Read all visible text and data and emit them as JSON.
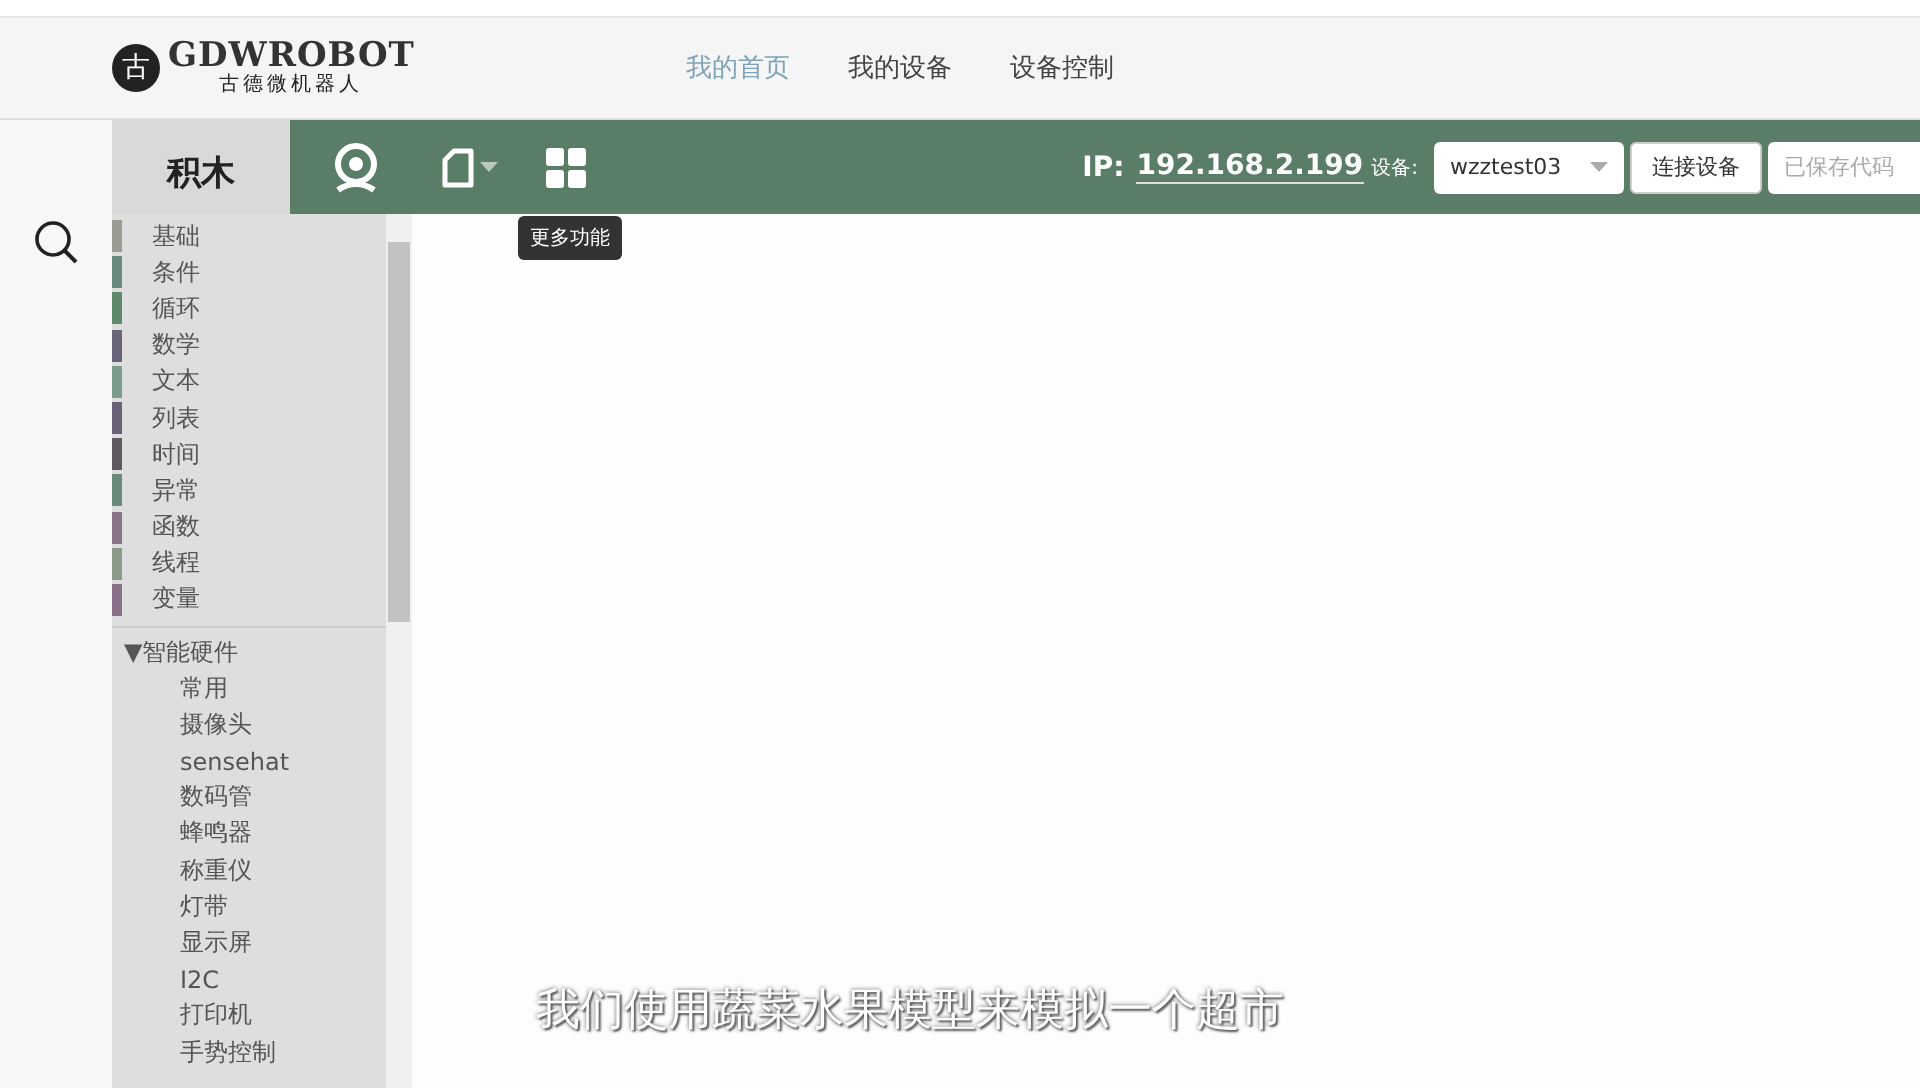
{
  "header": {
    "logo_title": "GDWROBOT",
    "logo_subtitle": "古德微机器人",
    "logo_glyph": "古",
    "nav": [
      {
        "label": "我的首页",
        "selected": true
      },
      {
        "label": "我的设备",
        "selected": false
      },
      {
        "label": "设备控制",
        "selected": false
      }
    ]
  },
  "toolbar": {
    "tab": "积木",
    "tooltip": "更多功能",
    "ip_label": "IP:",
    "ip": "192.168.2.199",
    "device_label": "设备:",
    "device": "wzztest03",
    "connect_button": "连接设备",
    "saved_code": "已保存代码"
  },
  "categories": [
    {
      "label": "基础",
      "color": "#9a9c94"
    },
    {
      "label": "条件",
      "color": "#6a8a80"
    },
    {
      "label": "循环",
      "color": "#5e8a6a"
    },
    {
      "label": "数学",
      "color": "#6a6478"
    },
    {
      "label": "文本",
      "color": "#7a9c8a"
    },
    {
      "label": "列表",
      "color": "#6a6078"
    },
    {
      "label": "时间",
      "color": "#605a60"
    },
    {
      "label": "异常",
      "color": "#6a8a7c"
    },
    {
      "label": "函数",
      "color": "#8a7488"
    },
    {
      "label": "线程",
      "color": "#8a9a88"
    },
    {
      "label": "变量",
      "color": "#8a7088"
    }
  ],
  "hardware": {
    "label": "智能硬件",
    "marker": "▼",
    "expanded": true,
    "children": [
      {
        "label": "常用"
      },
      {
        "label": "摄像头"
      },
      {
        "label": "sensehat"
      },
      {
        "label": "数码管"
      },
      {
        "label": "蜂鸣器"
      },
      {
        "label": "称重仪"
      },
      {
        "label": "灯带"
      },
      {
        "label": "显示屏"
      },
      {
        "label": "I2C"
      },
      {
        "label": "打印机"
      },
      {
        "label": "手势控制"
      }
    ]
  },
  "subtitle": "我们使用蔬菜水果模型来模拟一个超市"
}
